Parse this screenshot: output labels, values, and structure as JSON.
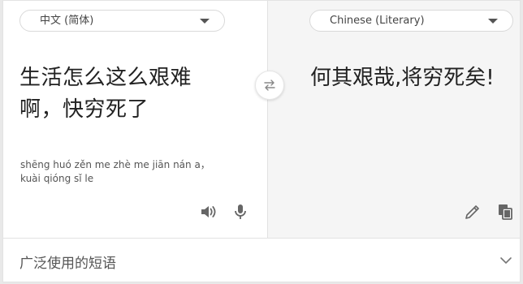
{
  "source": {
    "language": "中文 (简体)",
    "text_line1": "生活怎么这么艰难",
    "text_line2": "啊，快穷死了",
    "pinyin_line1": "shēng huó zěn me zhè me jiān nán a，",
    "pinyin_line2": "kuài qióng sǐ le"
  },
  "target": {
    "language": "Chinese (Literary)",
    "text": "何其艰哉,将穷死矣!"
  },
  "icons": {
    "swap": "swap-arrows-icon",
    "speaker": "speaker-icon",
    "microphone": "microphone-icon",
    "edit": "pencil-icon",
    "copy": "copy-icon",
    "expand": "chevron-down-icon"
  },
  "footer": {
    "label": "广泛使用的短语"
  },
  "colors": {
    "icon": "#666666",
    "target_pane_bg": "#f5f5f5"
  }
}
